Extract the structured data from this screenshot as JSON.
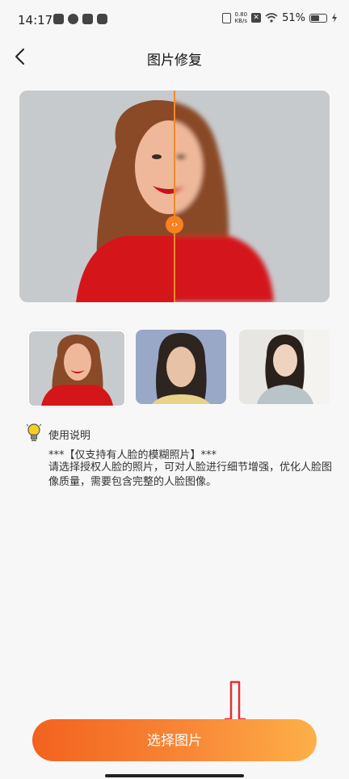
{
  "status_bar": {
    "time": "14:17",
    "net_speed_value": "0.80",
    "net_speed_unit": "KB/s",
    "battery_percent": "51%"
  },
  "nav": {
    "title": "图片修复"
  },
  "instructions": {
    "heading": "使用说明",
    "line1": "***【仅支持有人脸的模糊照片】***",
    "line2": "请选择授权人脸的照片，可对人脸进行细节增强，优化人脸图像质量，需要包含完整的人脸图像。"
  },
  "cta": {
    "label": "选择图片"
  },
  "colors": {
    "accent": "#f7801f",
    "button_gradient_start": "#f2621e",
    "button_gradient_end": "#fdb048",
    "annotation_arrow": "#e53030"
  },
  "icons": {
    "back": "chevron-left-icon",
    "tip": "lightbulb-icon",
    "compare_handle": "left-right-arrows-icon"
  }
}
